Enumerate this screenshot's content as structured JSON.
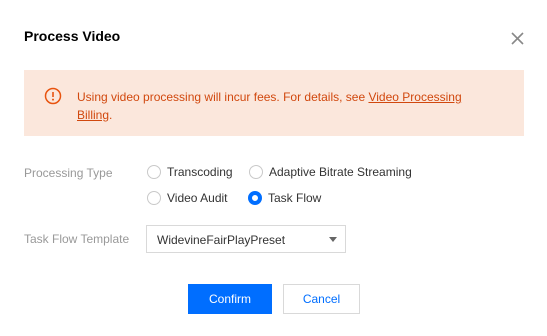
{
  "dialog": {
    "title": "Process Video",
    "close_icon": "close-icon"
  },
  "alert": {
    "icon": "warning-circle-icon",
    "text_prefix": "Using video processing will incur fees. For details, see ",
    "link_text": "Video Processing Billing",
    "text_suffix": ".",
    "color": "#d1480e",
    "background": "#fbe7dc"
  },
  "form": {
    "processing_type": {
      "label": "Processing Type",
      "options": [
        {
          "label": "Transcoding",
          "checked": false
        },
        {
          "label": "Adaptive Bitrate Streaming",
          "checked": false
        },
        {
          "label": "Video Audit",
          "checked": false
        },
        {
          "label": "Task Flow",
          "checked": true
        }
      ]
    },
    "task_flow_template": {
      "label": "Task Flow Template",
      "value": "WidevineFairPlayPreset"
    }
  },
  "buttons": {
    "confirm": "Confirm",
    "cancel": "Cancel"
  },
  "colors": {
    "primary": "#006eff"
  }
}
